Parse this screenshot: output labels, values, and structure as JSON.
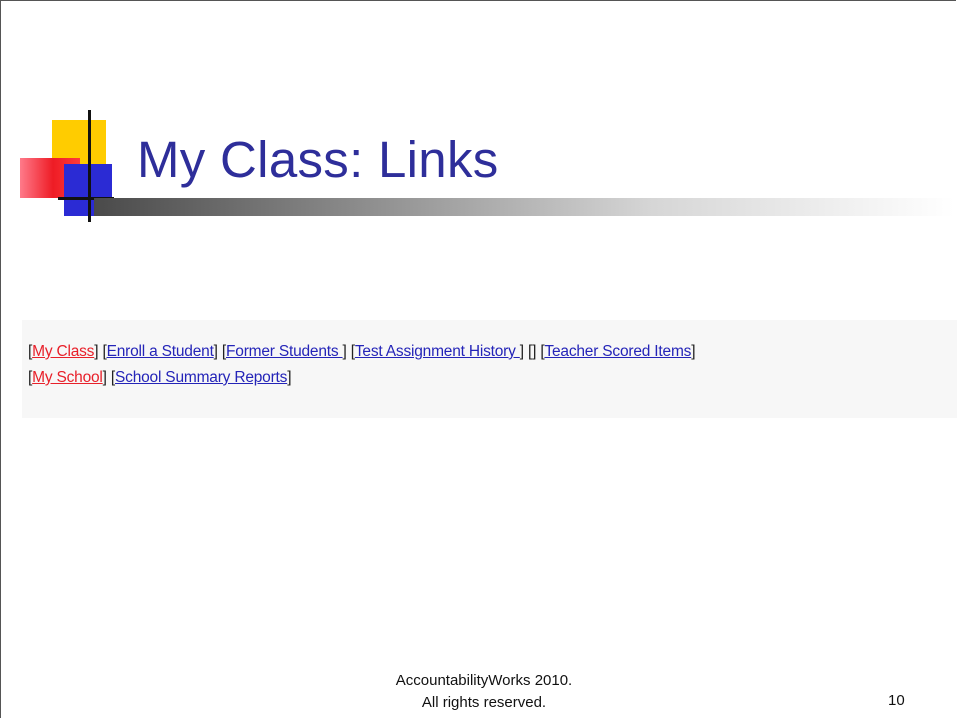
{
  "slide": {
    "title": "My Class: Links",
    "page_number": "10"
  },
  "nav_links": {
    "row1": [
      {
        "label": "My Class",
        "color": "#e8202a"
      },
      {
        "label": "Enroll a Student",
        "color": "#2424b8"
      },
      {
        "label": "Former Students ",
        "color": "#2424b8"
      },
      {
        "label": "Test Assignment History ",
        "color": "#2424b8"
      },
      {
        "label": "",
        "color": "#222222"
      },
      {
        "label": "Teacher Scored Items",
        "color": "#2424b8"
      }
    ],
    "row2": [
      {
        "label": "My School",
        "color": "#e8202a"
      },
      {
        "label": "School Summary Reports",
        "color": "#2424b8"
      }
    ]
  },
  "footer": {
    "line1": "AccountabilityWorks 2010.",
    "line2": "All rights reserved."
  },
  "colors": {
    "title": "#2e2e9a",
    "link_active": "#e8202a",
    "link": "#2424b8"
  }
}
